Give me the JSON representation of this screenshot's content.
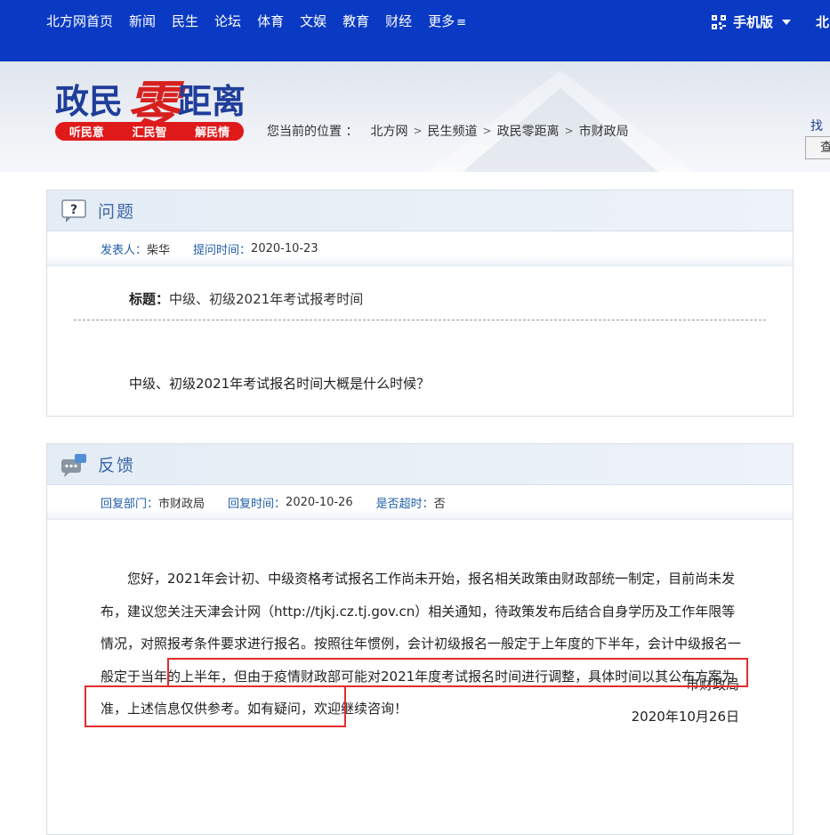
{
  "topnav": {
    "links": [
      "北方网首页",
      "新闻",
      "民生",
      "论坛",
      "体育",
      "文娱",
      "教育",
      "财经",
      "更多"
    ],
    "menu_glyph": "≡",
    "mobile_label": "手机版",
    "edge_text": "北"
  },
  "banner": {
    "logo_part1": "政民",
    "logo_zero": "零",
    "logo_part2": "距离",
    "slogans": [
      "听民意",
      "汇民智",
      "解民情"
    ],
    "breadcrumb_label": "您当前的位置 ：",
    "breadcrumb": [
      "北方网",
      "民生频道",
      "政民零距离",
      "市财政局"
    ],
    "right_link": "找",
    "right_button": "查"
  },
  "question": {
    "heading": "问题",
    "poster_label": "发表人：",
    "poster": "柴华",
    "time_label": "提问时间：",
    "time": "2020-10-23",
    "title_label": "标题：",
    "title": "中级、初级2021年考试报考时间",
    "body": "中级、初级2021年考试报名时间大概是什么时候？"
  },
  "feedback": {
    "heading": "反馈",
    "dept_label": "回复部门：",
    "dept": "市财政局",
    "time_label": "回复时间：",
    "time": "2020-10-26",
    "overdue_label": "是否超时：",
    "overdue": "否",
    "body": "您好，2021年会计初、中级资格考试报名工作尚未开始，报名相关政策由财政部统一制定，目前尚未发布，建议您关注天津会计网（http://tjkj.cz.tj.gov.cn）相关通知，待政策发布后结合自身学历及工作年限等情况，对照报考条件要求进行报名。按照往年惯例，会计初级报名一般定于上年度的下半年，会计中级报名一般定于当年的上半年，但由于疫情财政部可能对2021年度考试报名时间进行调整，具体时间以其公布方案为准，上述信息仅供参考。如有疑问，欢迎继续咨询！",
    "signature": "市财政局",
    "date": "2020年10月26日"
  },
  "colors": {
    "nav_bg": "#0a3ac4",
    "accent_blue": "#1f5ea8",
    "highlight_red": "#e52b2b"
  }
}
